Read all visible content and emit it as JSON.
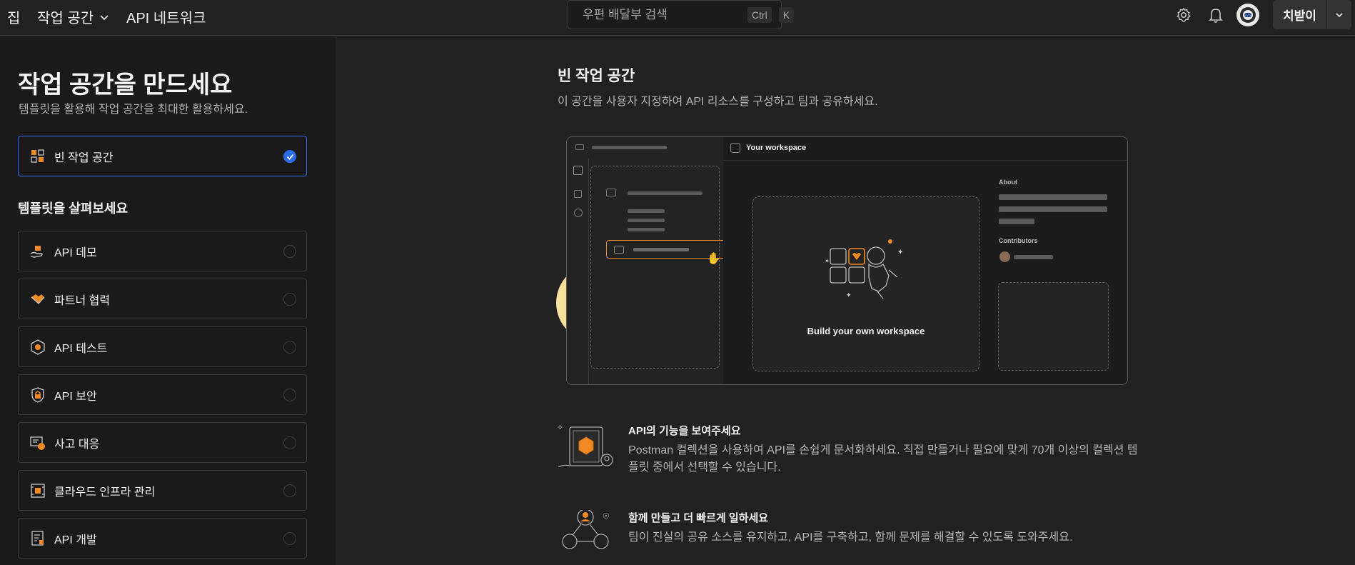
{
  "topbar": {
    "home": "집",
    "workspace": "작업 공간",
    "api_network": "API 네트워크",
    "search_placeholder": "우편 배달부 검색",
    "shortcut_ctrl": "Ctrl",
    "shortcut_key": "K",
    "user_button": "치받이"
  },
  "left": {
    "title": "작업 공간을 만드세요",
    "subtitle": "템플릿을 활용해 작업 공간을 최대한 활용하세요.",
    "blank_option": "빈 작업 공간",
    "templates_heading": "템플릿을 살펴보세요",
    "templates": [
      {
        "label": "API 데모",
        "icon": "hand-box-icon"
      },
      {
        "label": "파트너 협력",
        "icon": "handshake-icon"
      },
      {
        "label": "API 테스트",
        "icon": "gear-hex-icon"
      },
      {
        "label": "API 보안",
        "icon": "lock-shield-icon"
      },
      {
        "label": "사고 대응",
        "icon": "alert-monitor-icon"
      },
      {
        "label": "클라우드 인프라 관리",
        "icon": "server-icon"
      },
      {
        "label": "API 개발",
        "icon": "document-code-icon"
      }
    ]
  },
  "main": {
    "title": "빈 작업 공간",
    "subtitle": "이 공간을 사용자 지정하여 API 리소스를 구성하고 팀과 공유하세요.",
    "preview": {
      "header": "Your workspace",
      "center_caption": "Build your own workspace",
      "about_label": "About",
      "contributors_label": "Contributors"
    },
    "features": [
      {
        "title": "API의 기능을 보여주세요",
        "desc": "Postman 컬렉션을 사용하여 API를 손쉽게 문서화하세요. 직접 만들거나 필요에 맞게 70개 이상의 컬렉션 템플릿 중에서 선택할 수 있습니다."
      },
      {
        "title": "함께 만들고 더 빠르게 일하세요",
        "desc": "팀이 진실의 공유 소스를 유지하고, API를 구축하고, 함께 문제를 해결할 수 있도록 도와주세요."
      }
    ]
  },
  "colors": {
    "accent": "#2a6be8",
    "orange": "#f08a24",
    "yellow": "#f5d67a"
  }
}
